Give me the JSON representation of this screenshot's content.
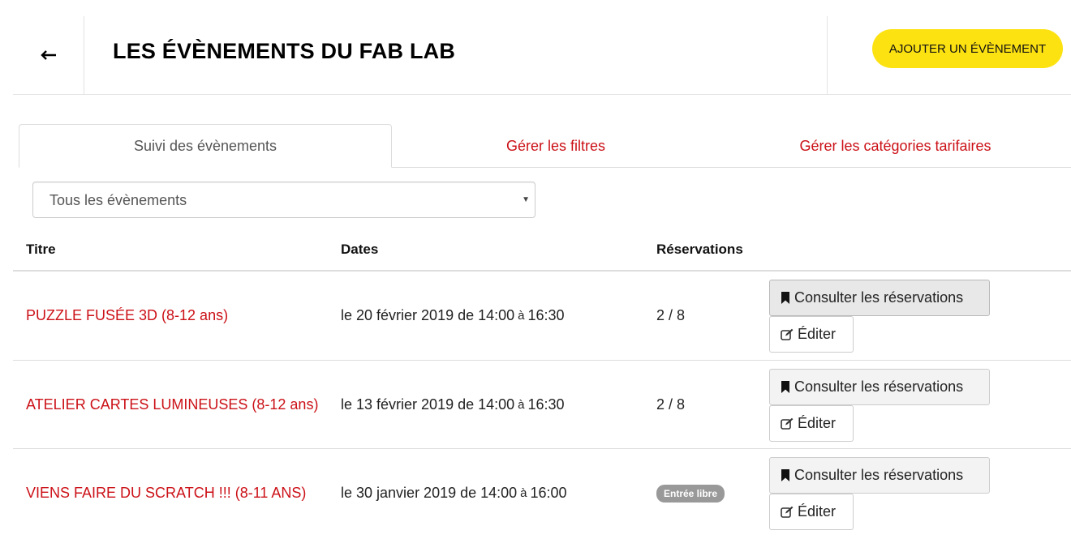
{
  "header": {
    "back_icon": "arrow-left-icon",
    "title": "LES ÉVÈNEMENTS DU FAB LAB",
    "add_button_label": "AJOUTER UN ÉVÈNEMENT",
    "add_button_color": "#fde212"
  },
  "tabs": [
    {
      "label": "Suivi des évènements",
      "active": true
    },
    {
      "label": "Gérer les filtres",
      "active": false
    },
    {
      "label": "Gérer les catégories tarifaires",
      "active": false
    }
  ],
  "filter": {
    "selected": "Tous les évènements"
  },
  "table": {
    "headers": {
      "title": "Titre",
      "dates": "Dates",
      "reservations": "Réservations"
    },
    "rows": [
      {
        "title": "PUZZLE FUSÉE 3D (8-12 ans)",
        "date_start": "le 20 février 2019 de 14:00",
        "date_sep": "à",
        "date_end": "16:30",
        "reservations": "2 / 8",
        "badge": "",
        "consult_label": "Consulter les réservations",
        "edit_label": "Éditer"
      },
      {
        "title": "ATELIER CARTES LUMINEUSES (8-12 ans)",
        "date_start": "le 13 février 2019 de 14:00",
        "date_sep": "à",
        "date_end": "16:30",
        "reservations": "2 / 8",
        "badge": "",
        "consult_label": "Consulter les réservations",
        "edit_label": "Éditer"
      },
      {
        "title": "VIENS FAIRE DU SCRATCH !!! (8-11 ANS)",
        "date_start": "le 30 janvier 2019 de 14:00",
        "date_sep": "à",
        "date_end": "16:00",
        "reservations": "",
        "badge": "Entrée libre",
        "consult_label": "Consulter les réservations",
        "edit_label": "Éditer"
      }
    ]
  },
  "colors": {
    "link": "#cb1117",
    "accent": "#fde212",
    "badge": "#999999"
  }
}
